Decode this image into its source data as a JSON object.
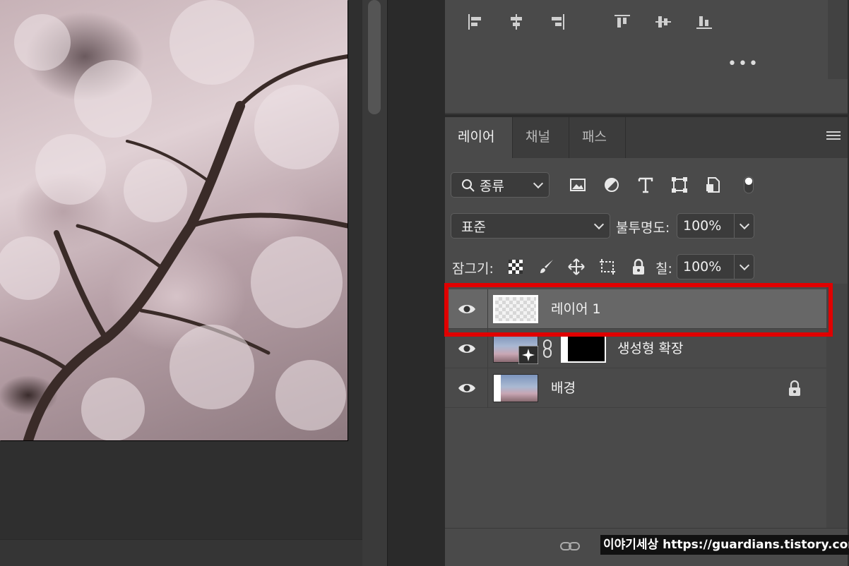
{
  "align_panel": {
    "icons": [
      "align-left-icon",
      "align-horizontal-center-icon",
      "align-right-icon",
      "align-top-icon",
      "align-vertical-center-icon",
      "align-bottom-icon"
    ],
    "more_label": "•••"
  },
  "layers_panel": {
    "tabs": [
      {
        "label": "레이어",
        "active": true
      },
      {
        "label": "채널",
        "active": false
      },
      {
        "label": "패스",
        "active": false
      }
    ],
    "filter": {
      "label": "종류"
    },
    "blend_mode": "표준",
    "opacity_label": "불투명도:",
    "opacity_value": "100%",
    "lock_label": "잠그기:",
    "fill_label": "칠:",
    "fill_value": "100%",
    "layers": [
      {
        "name": "레이어 1",
        "selected": true,
        "type": "transparent"
      },
      {
        "name": "생성형 확장",
        "selected": false,
        "type": "generative"
      },
      {
        "name": "배경",
        "selected": false,
        "type": "background",
        "locked": true
      }
    ]
  },
  "watermark": "이야기세상 https://guardians.tistory.com",
  "colors": {
    "highlight": "#e00000",
    "panel_bg": "#4a4a4a",
    "selected_row": "#676767"
  }
}
